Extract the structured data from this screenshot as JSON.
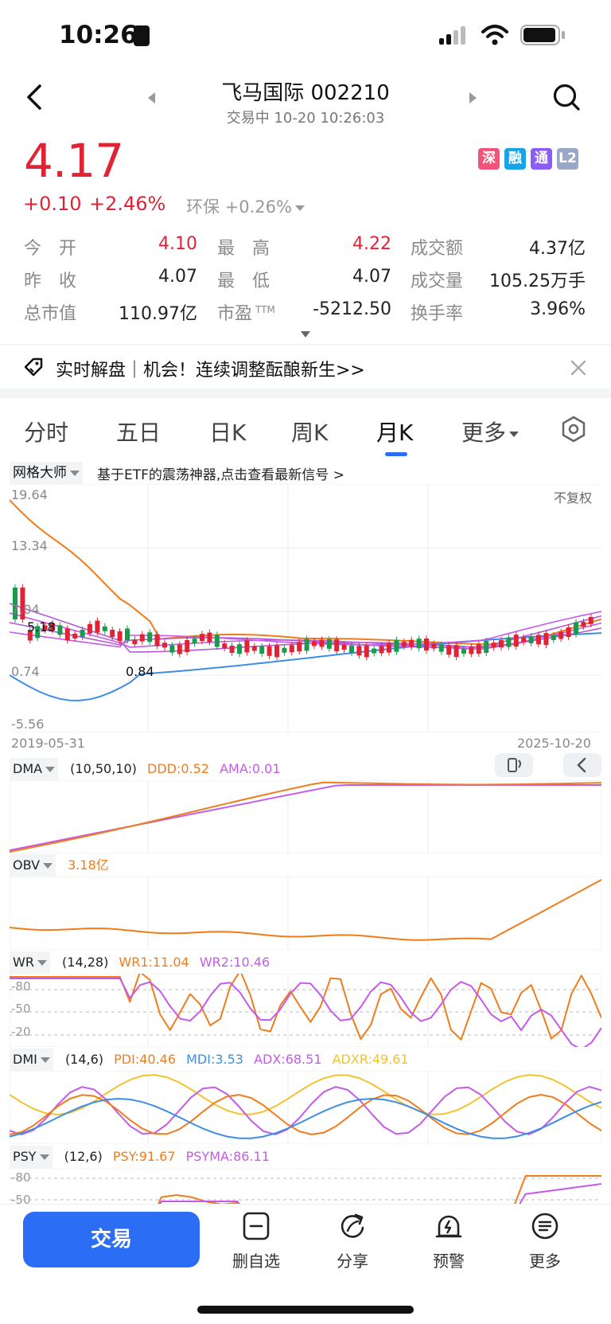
{
  "status": {
    "time": "10:26"
  },
  "header": {
    "title": "飞马国际 002210",
    "subtitle": "交易中 10-20 10:26:03"
  },
  "quote": {
    "price": "4.17",
    "change": "+0.10",
    "change_pct": "+2.46%",
    "sector": "环保 +0.26%",
    "badges": [
      {
        "text": "深",
        "color": "#f0547a"
      },
      {
        "text": "融",
        "color": "#1aa3e8"
      },
      {
        "text": "通",
        "color": "#8b5cf6"
      },
      {
        "text": "L2",
        "color": "#9aa8c8"
      }
    ],
    "stats": [
      {
        "label": "今　开",
        "value": "4.10"
      },
      {
        "label": "最　高",
        "value": "4.22"
      },
      {
        "label": "成交额",
        "value": "4.37亿"
      },
      {
        "label": "昨　收",
        "value": "4.07"
      },
      {
        "label": "最　低",
        "value": "4.07"
      },
      {
        "label": "成交量",
        "value": "105.25万手"
      },
      {
        "label": "总市值",
        "value": "110.97亿"
      },
      {
        "label": "市盈",
        "value": "-5212.50"
      },
      {
        "label": "换手率",
        "value": "3.96%"
      }
    ],
    "pe_sup": "TTM"
  },
  "banner": {
    "text": "实时解盘｜机会！连续调整酝酿新生>>"
  },
  "tabs": [
    {
      "label": "分时"
    },
    {
      "label": "五日"
    },
    {
      "label": "日K"
    },
    {
      "label": "周K"
    },
    {
      "label": "月K"
    },
    {
      "label": "更多"
    }
  ],
  "grid_master": {
    "label": "网格大师",
    "text": "基于ETF的震荡神器,点击查看最新信号 >"
  },
  "main_chart": {
    "fq": "不复权",
    "y_labels": [
      "19.64",
      "13.34",
      "7.04",
      "0.74",
      "-5.56"
    ],
    "high_label": "5.18",
    "low_label": "0.84",
    "date_start": "2019-05-31",
    "date_end": "2025-10-20"
  },
  "indicators": {
    "dma": {
      "name": "DMA",
      "params": "(10,50,10)",
      "v1": "DDD:0.52",
      "v2": "AMA:0.01"
    },
    "obv": {
      "name": "OBV",
      "v1": "3.18亿"
    },
    "wr": {
      "name": "WR",
      "params": "(14,28)",
      "v1": "WR1:11.04",
      "v2": "WR2:10.46",
      "y_labels": [
        "-80",
        "-50",
        "-20"
      ]
    },
    "dmi": {
      "name": "DMI",
      "params": "(14,6)",
      "v1": "PDI:40.46",
      "v2": "MDI:3.53",
      "v3": "ADX:68.51",
      "v4": "ADXR:49.61"
    },
    "psy": {
      "name": "PSY",
      "params": "(12,6)",
      "v1": "PSY:91.67",
      "v2": "PSYMA:86.11",
      "y_labels": [
        "-80",
        "-50"
      ]
    }
  },
  "colors": {
    "red": "#e02436",
    "green": "#1a9b4b",
    "orange": "#f07c1b",
    "purple": "#c45be8",
    "blue": "#3d8ee6",
    "yellow": "#f2c230",
    "accent": "#2c6df5"
  },
  "bottom_bar": {
    "trade": "交易",
    "items": [
      {
        "label": "删自选",
        "icon": "minus-box-icon"
      },
      {
        "label": "分享",
        "icon": "share-icon"
      },
      {
        "label": "预警",
        "icon": "alert-icon"
      },
      {
        "label": "更多",
        "icon": "more-icon"
      }
    ]
  }
}
